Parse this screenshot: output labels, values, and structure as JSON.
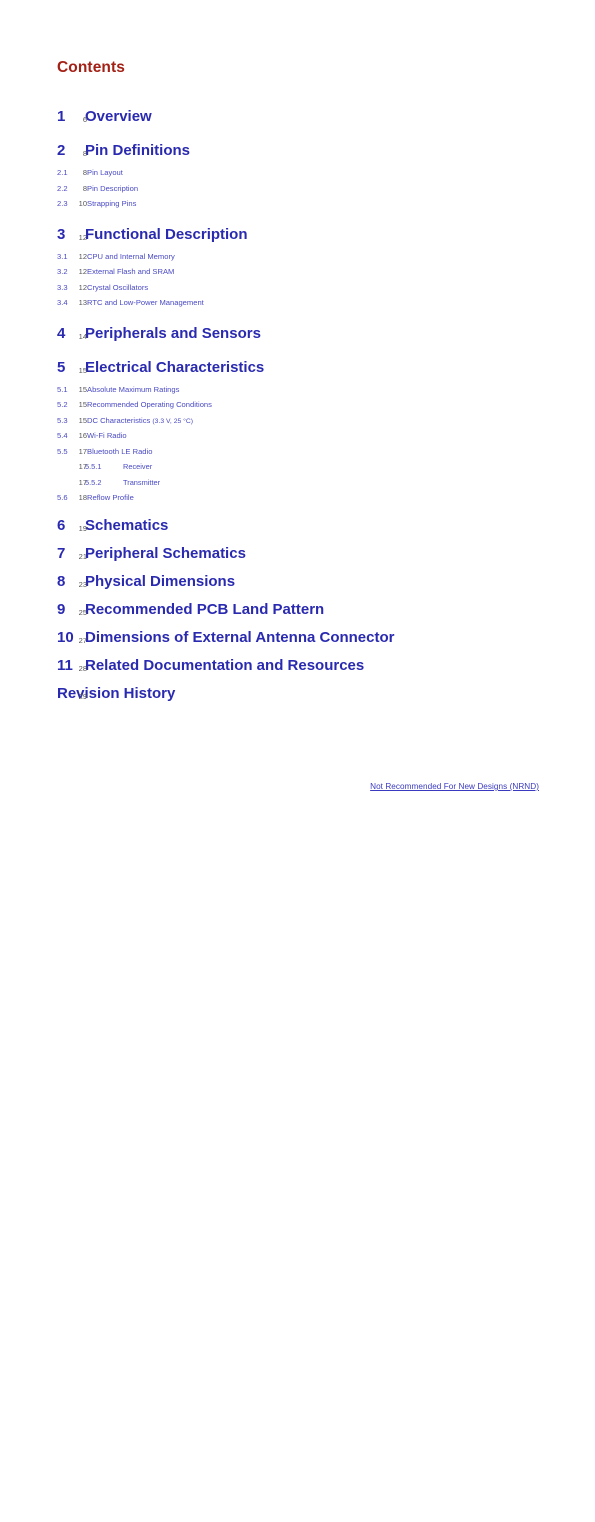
{
  "document": {
    "heading": "Contents",
    "heading_color": "#a32015",
    "chapter_color": "#2a2ab0",
    "section_color": "#4a4ac4",
    "page_number_color": "#555555"
  },
  "toc": {
    "entries": [
      {
        "level": 1,
        "number": "1",
        "label": "Overview",
        "page": "6",
        "gap_before": "none"
      },
      {
        "level": 1,
        "number": "2",
        "label": "Pin Definitions",
        "page": "8",
        "gap_before": "sm"
      },
      {
        "level": 2,
        "number": "2.1",
        "label": "Pin Layout",
        "page": "8",
        "gap_before": "none"
      },
      {
        "level": 2,
        "number": "2.2",
        "label": "Pin Description",
        "page": "8",
        "gap_before": "none"
      },
      {
        "level": 2,
        "number": "2.3",
        "label": "Strapping Pins",
        "page": "10",
        "gap_before": "none"
      },
      {
        "level": 1,
        "number": "3",
        "label": "Functional Description",
        "page": "12",
        "gap_before": "md"
      },
      {
        "level": 2,
        "number": "3.1",
        "label": "CPU and Internal Memory",
        "page": "12",
        "gap_before": "none"
      },
      {
        "level": 2,
        "number": "3.2",
        "label": "External Flash and SRAM",
        "page": "12",
        "gap_before": "none"
      },
      {
        "level": 2,
        "number": "3.3",
        "label": "Crystal Oscillators",
        "page": "12",
        "gap_before": "none"
      },
      {
        "level": 2,
        "number": "3.4",
        "label": "RTC and Low-Power Management",
        "page": "13",
        "gap_before": "none"
      },
      {
        "level": 1,
        "number": "4",
        "label": "Peripherals and Sensors",
        "page": "14",
        "gap_before": "md"
      },
      {
        "level": 1,
        "number": "5",
        "label": "Electrical Characteristics",
        "page": "15",
        "gap_before": "sm"
      },
      {
        "level": 2,
        "number": "5.1",
        "label": "Absolute Maximum Ratings",
        "page": "15",
        "gap_before": "none"
      },
      {
        "level": 2,
        "number": "5.2",
        "label": "Recommended Operating Conditions",
        "page": "15",
        "gap_before": "none"
      },
      {
        "level": 2,
        "number": "5.3",
        "label": "DC Characteristics ",
        "label_paren": "(3.3 V, 25 °C)",
        "page": "15",
        "gap_before": "none"
      },
      {
        "level": 2,
        "number": "5.4",
        "label": "Wi-Fi Radio",
        "page": "16",
        "gap_before": "none"
      },
      {
        "level": 2,
        "number": "5.5",
        "label": "Bluetooth LE Radio",
        "page": "17",
        "gap_before": "none"
      },
      {
        "level": 3,
        "number": "5.5.1",
        "label": "Receiver",
        "page": "17",
        "gap_before": "none"
      },
      {
        "level": 3,
        "number": "5.5.2",
        "label": "Transmitter",
        "page": "17",
        "gap_before": "none"
      },
      {
        "level": 2,
        "number": "5.6",
        "label": "Reflow Profile",
        "page": "18",
        "gap_before": "none"
      },
      {
        "level": 1,
        "number": "6",
        "label": "Schematics",
        "page": "19",
        "gap_before": "sm"
      },
      {
        "level": 1,
        "number": "7",
        "label": "Peripheral Schematics",
        "page": "21",
        "gap_before": "none"
      },
      {
        "level": 1,
        "number": "8",
        "label": "Physical Dimensions",
        "page": "23",
        "gap_before": "none"
      },
      {
        "level": 1,
        "number": "9",
        "label": "Recommended PCB Land Pattern",
        "page": "25",
        "gap_before": "none"
      },
      {
        "level": 1,
        "number": "10",
        "label": "Dimensions of External Antenna Connector",
        "page": "27",
        "gap_before": "none"
      },
      {
        "level": 1,
        "number": "11",
        "label": "Related Documentation and Resources",
        "page": "28",
        "gap_before": "none"
      },
      {
        "level": 1,
        "number": "",
        "label": "Revision History",
        "page": "29",
        "gap_before": "none"
      }
    ]
  },
  "footer": {
    "notice": "Not Recommended For New Designs (NRND)"
  }
}
